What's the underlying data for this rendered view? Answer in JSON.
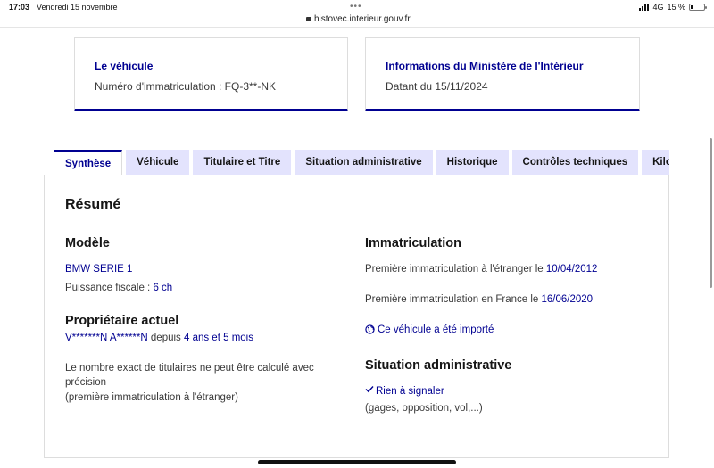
{
  "status_bar": {
    "time": "17:03",
    "date": "Vendredi 15 novembre",
    "network": "4G",
    "battery": "15 %",
    "battery_level": 0.15
  },
  "browser": {
    "url": "histovec.interieur.gouv.fr"
  },
  "cards": {
    "vehicle": {
      "title": "Le véhicule",
      "text": "Numéro d'immatriculation : FQ-3**-NK"
    },
    "ministry": {
      "title": "Informations du Ministère de l'Intérieur",
      "text": "Datant du 15/11/2024"
    }
  },
  "tabs": [
    {
      "label": "Synthèse",
      "active": true
    },
    {
      "label": "Véhicule",
      "active": false
    },
    {
      "label": "Titulaire et Titre",
      "active": false
    },
    {
      "label": "Situation administrative",
      "active": false
    },
    {
      "label": "Historique",
      "active": false
    },
    {
      "label": "Contrôles techniques",
      "active": false
    },
    {
      "label": "Kilo",
      "active": false
    }
  ],
  "summary": {
    "title": "Résumé",
    "model": {
      "heading": "Modèle",
      "name": "BMW SERIE 1",
      "power_label": "Puissance fiscale : ",
      "power_value": "6 ch"
    },
    "owner": {
      "heading": "Propriétaire actuel",
      "name": "V*******N A******N",
      "since_label": " depuis ",
      "duration": "4 ans et 5 mois",
      "note_line1": "Le nombre exact de titulaires ne peut être calculé avec",
      "note_line2": "précision",
      "note_line3": "(première immatriculation à l'étranger)"
    },
    "registration": {
      "heading": "Immatriculation",
      "foreign_label": "Première immatriculation à l'étranger le ",
      "foreign_date": "10/04/2012",
      "france_label": "Première immatriculation en France le ",
      "france_date": "16/06/2020",
      "imported_link": "Ce véhicule a été importé"
    },
    "admin": {
      "heading": "Situation administrative",
      "status": "Rien à signaler",
      "details": "(gages, opposition, vol,...)"
    }
  }
}
